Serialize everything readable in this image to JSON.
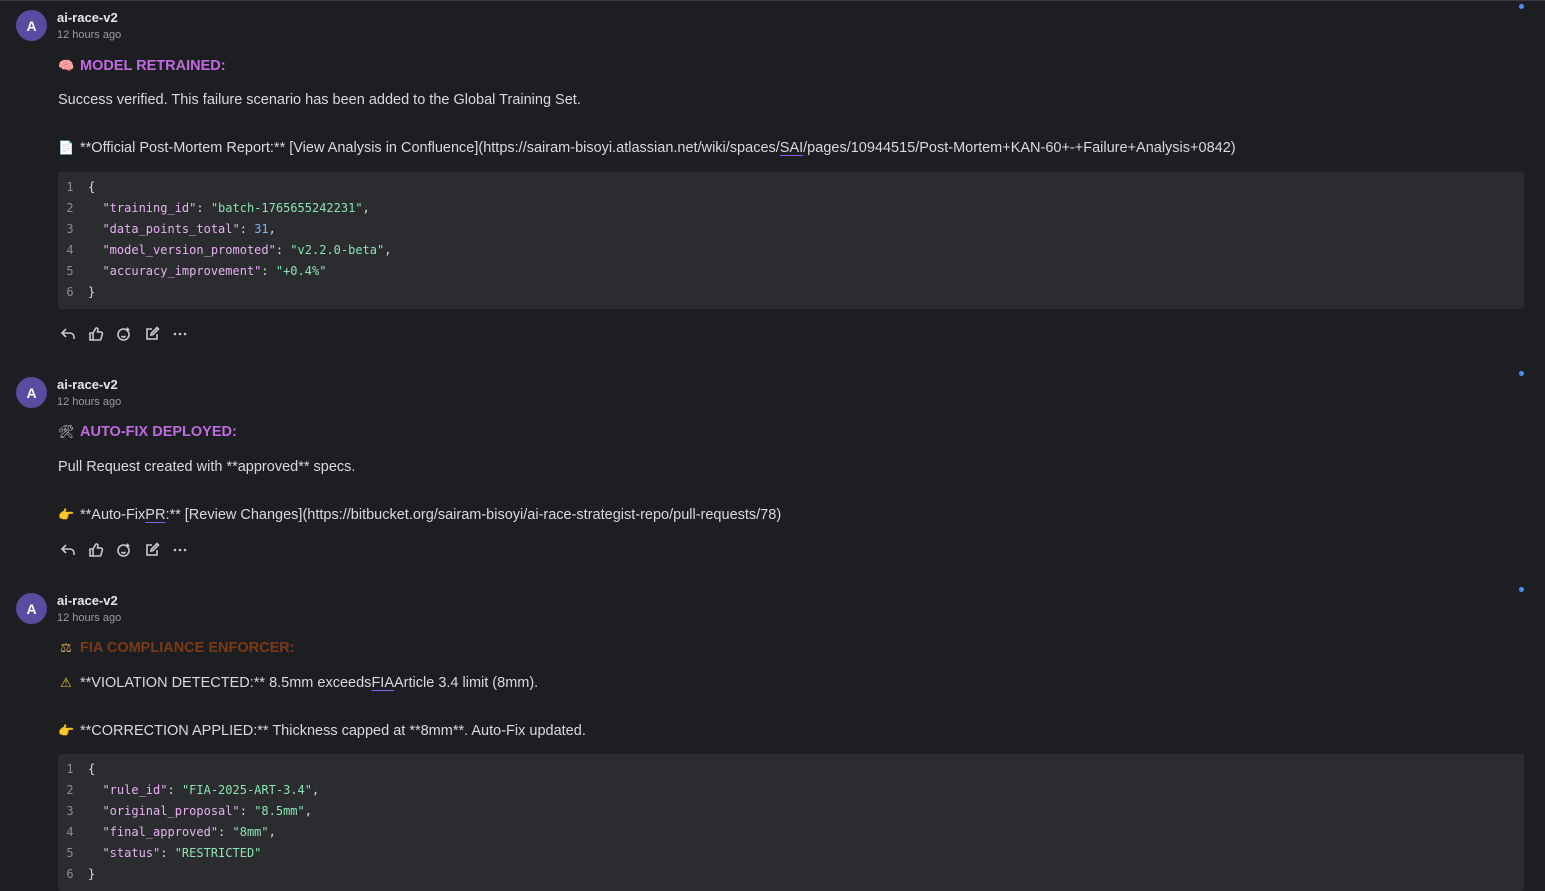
{
  "comments": [
    {
      "avatar": "A",
      "author": "ai-race-v2",
      "time": "12 hours ago",
      "heading_emoji": "🧠",
      "heading": "MODEL RETRAINED:",
      "body1": "Success verified. This failure scenario has been added to the Global Training Set.",
      "link_emoji": "📄",
      "link_pre": "**Official Post-Mortem Report:** [View Analysis in Confluence](https://sairam-bisoyi.atlassian.net/wiki/spaces/",
      "link_u": "SAI",
      "link_post": "/pages/10944515/Post-Mortem+KAN-60+-+Failure+Analysis+0842)",
      "code": [
        {
          "n": "1",
          "text": "{"
        },
        {
          "n": "2",
          "key": "\"training_id\"",
          "val": "\"batch-1765655242231\"",
          "type": "s",
          "end": ","
        },
        {
          "n": "3",
          "key": "\"data_points_total\"",
          "val": "31",
          "type": "n",
          "end": ","
        },
        {
          "n": "4",
          "key": "\"model_version_promoted\"",
          "val": "\"v2.2.0-beta\"",
          "type": "s",
          "end": ","
        },
        {
          "n": "5",
          "key": "\"accuracy_improvement\"",
          "val": "\"+0.4%\"",
          "type": "s",
          "end": ""
        },
        {
          "n": "6",
          "text": "}"
        }
      ]
    },
    {
      "avatar": "A",
      "author": "ai-race-v2",
      "time": "12 hours ago",
      "heading_emoji": "🛠",
      "heading": "AUTO-FIX DEPLOYED:",
      "body1": "Pull Request created with **approved** specs.",
      "link_emoji": "👉",
      "link_pre": "**Auto-Fix ",
      "link_u": "PR",
      "link_post": ":** [Review Changes](https://bitbucket.org/sairam-bisoyi/ai-race-strategist-repo/pull-requests/78)"
    },
    {
      "avatar": "A",
      "author": "ai-race-v2",
      "time": "12 hours ago",
      "heading_emoji": "⚖",
      "heading": "FIA COMPLIANCE ENFORCER:",
      "warn_emoji": "⚠",
      "warn_pre": "**VIOLATION DETECTED:** 8.5mm exceeds ",
      "warn_u": "FIA",
      "warn_post": " Article 3.4 limit (8mm).",
      "link_emoji": "👉",
      "correction": "**CORRECTION APPLIED:** Thickness capped at **8mm**. Auto-Fix updated.",
      "code": [
        {
          "n": "1",
          "text": "{"
        },
        {
          "n": "2",
          "key": "\"rule_id\"",
          "val": "\"FIA-2025-ART-3.4\"",
          "type": "s",
          "end": ","
        },
        {
          "n": "3",
          "key": "\"original_proposal\"",
          "val": "\"8.5mm\"",
          "type": "s",
          "end": ","
        },
        {
          "n": "4",
          "key": "\"final_approved\"",
          "val": "\"8mm\"",
          "type": "s",
          "end": ","
        },
        {
          "n": "5",
          "key": "\"status\"",
          "val": "\"RESTRICTED\"",
          "type": "s",
          "end": ""
        },
        {
          "n": "6",
          "text": "}"
        }
      ]
    }
  ],
  "actions": [
    "reply-icon",
    "thumbs-up-icon",
    "add-reaction-icon",
    "edit-icon",
    "more-icon"
  ]
}
